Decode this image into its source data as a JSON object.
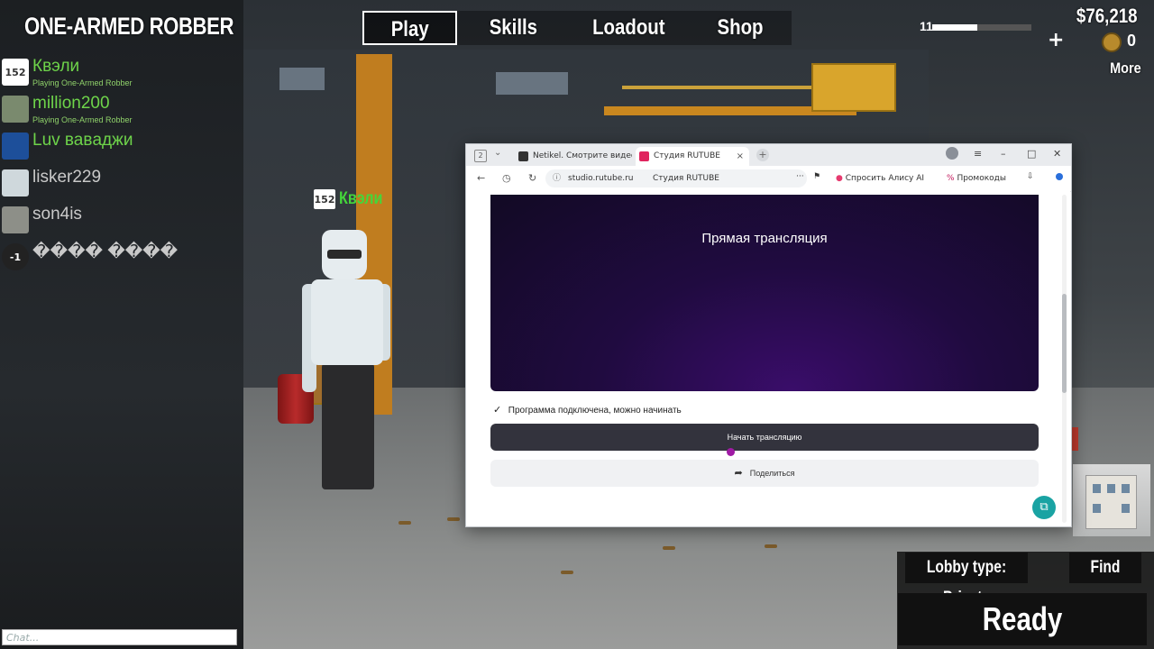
{
  "game": {
    "title": "ONE-ARMED ROBBER",
    "nav": [
      {
        "label": "Play",
        "active": true
      },
      {
        "label": "Skills",
        "active": false
      },
      {
        "label": "Loadout",
        "active": false
      },
      {
        "label": "Shop",
        "active": false
      }
    ],
    "level": "11",
    "xp_fraction": 0.45,
    "money": "$76,218",
    "plus": "+",
    "coins": "0",
    "more": "More",
    "players": [
      {
        "name": "Квэли",
        "sub": "Playing One-Armed Robber",
        "color": "#6ed44a",
        "avatar_text": "152"
      },
      {
        "name": "million200",
        "sub": "Playing One-Armed Robber",
        "color": "#6ed44a",
        "avatar_text": ""
      },
      {
        "name": "Luv вавaджи",
        "sub": "",
        "color": "#6ed44a",
        "avatar_text": ""
      },
      {
        "name": "lisker229",
        "sub": "",
        "color": "#c9c9c9",
        "avatar_text": ""
      },
      {
        "name": "son4is",
        "sub": "",
        "color": "#c9c9c9",
        "avatar_text": ""
      },
      {
        "name": "���� ����",
        "sub": "",
        "color": "#c9c9c9",
        "avatar_text": "-1"
      }
    ],
    "nametag": {
      "level": "152",
      "name": "Квэли"
    },
    "chat_placeholder": "Chat...",
    "lobby_type": "Lobby type: Private",
    "find_game": "Find game",
    "ready": "Ready"
  },
  "browser": {
    "tab_count": "2",
    "tabs": [
      {
        "label": "Netikel. Смотрите видео о",
        "favicon_color": "#333333",
        "active": false
      },
      {
        "label": "Студия RUTUBE",
        "favicon_color": "#e0245e",
        "active": true
      }
    ],
    "close_glyph": "×",
    "new_tab": "+",
    "url_host": "studio.rutube.ru",
    "url_title": "Студия RUTUBE",
    "ext_alice": "Спросить Алису AI",
    "ext_promo": "Промокоды",
    "preview_title": "Прямая трансляция",
    "status_text": "Программа подключена, можно начинать",
    "start_button": "Начать трансляцию",
    "share_button": "Поделиться"
  }
}
